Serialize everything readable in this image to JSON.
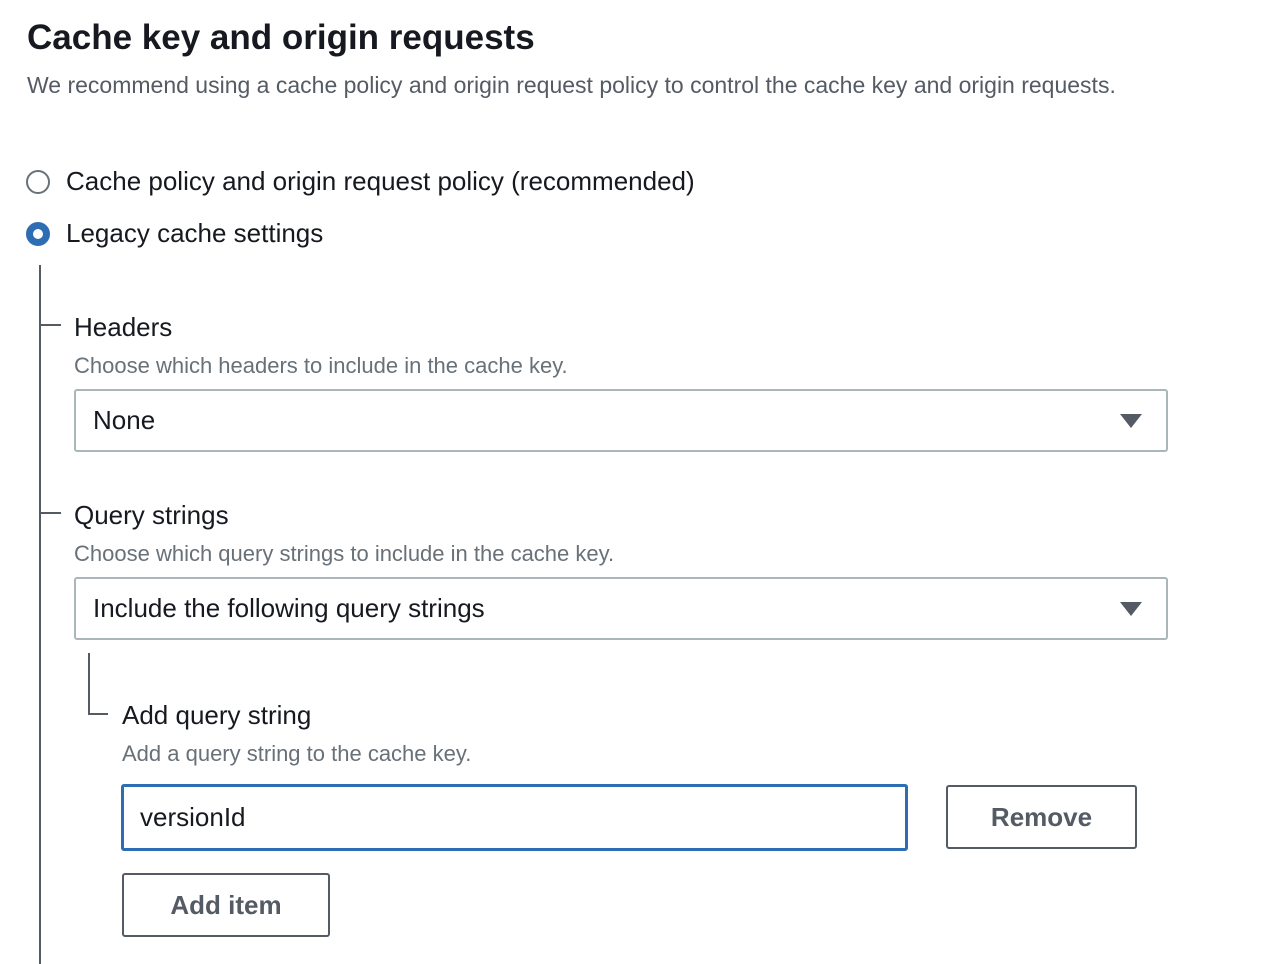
{
  "section": {
    "title": "Cache key and origin requests",
    "description": "We recommend using a cache policy and origin request policy to control the cache key and origin requests."
  },
  "radio_options": [
    {
      "label": "Cache policy and origin request policy (recommended)",
      "checked": false
    },
    {
      "label": "Legacy cache settings",
      "checked": true
    }
  ],
  "headers": {
    "label": "Headers",
    "description": "Choose which headers to include in the cache key.",
    "selected": "None"
  },
  "query_strings": {
    "label": "Query strings",
    "description": "Choose which query strings to include in the cache key.",
    "selected": "Include the following query strings"
  },
  "add_query_string": {
    "label": "Add query string",
    "description": "Add a query string to the cache key.",
    "value": "versionId",
    "remove_label": "Remove",
    "add_item_label": "Add item"
  },
  "colors": {
    "accent": "#2d6db4",
    "text": "#16191f",
    "muted": "#687078",
    "border": "#aab7b8"
  }
}
